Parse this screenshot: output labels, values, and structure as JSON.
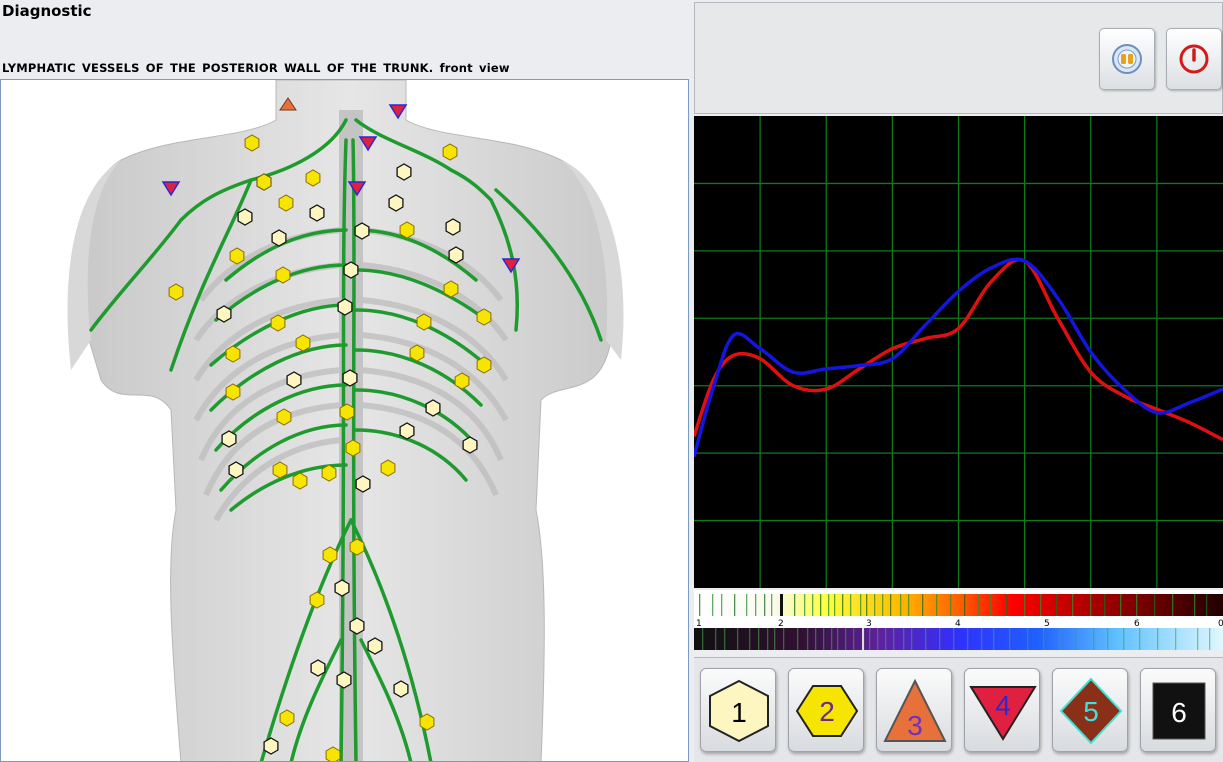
{
  "window": {
    "title": "Diagnostic",
    "subtitle": "LYMPHATIC VESSELS OF THE POSTERIOR WALL OF THE TRUNK. front view"
  },
  "colors": {
    "lymph_vessel": "#1f9a2e",
    "point_light": "#fdf6c0",
    "point_yellow": "#f5e500",
    "marker_orange": "#e8703a",
    "marker_red": "#e02040",
    "marker_blue": "#2a2ad0",
    "curve_red": "#e01010",
    "curve_blue": "#1515e0",
    "grid_green": "#0e7a1a"
  },
  "toolbar": {
    "audio_icon": "audio-icon",
    "power_icon": "power-icon"
  },
  "spectrum": {
    "scale_labels": [
      "1",
      "2",
      "3",
      "4",
      "5",
      "6",
      "0"
    ]
  },
  "mode_buttons": [
    {
      "label": "1",
      "shape": "hexagon-light"
    },
    {
      "label": "2",
      "shape": "hexagon-yellow"
    },
    {
      "label": "3",
      "shape": "triangle-up-orange"
    },
    {
      "label": "4",
      "shape": "triangle-down-red"
    },
    {
      "label": "5",
      "shape": "diamond-brown"
    },
    {
      "label": "6",
      "shape": "square-black"
    }
  ],
  "chart_data": {
    "type": "line",
    "title": "",
    "xlabel": "",
    "ylabel": "",
    "xlim": [
      0,
      8
    ],
    "ylim": [
      0,
      7
    ],
    "grid": true,
    "series": [
      {
        "color": "#e01010",
        "x": [
          0,
          0.3,
          0.6,
          1,
          1.5,
          2,
          2.5,
          3,
          3.5,
          4,
          4.5,
          5,
          5.5,
          6,
          6.5,
          7,
          7.5,
          8
        ],
        "y": [
          2.25,
          3.1,
          3.45,
          3.4,
          3.0,
          2.95,
          3.25,
          3.55,
          3.7,
          3.85,
          4.55,
          4.85,
          4.0,
          3.2,
          2.85,
          2.65,
          2.45,
          2.2
        ]
      },
      {
        "color": "#1515e0",
        "x": [
          0,
          0.3,
          0.6,
          1,
          1.5,
          2,
          2.5,
          3,
          3.5,
          4,
          4.5,
          5,
          5.5,
          6,
          6.5,
          7,
          7.5,
          8
        ],
        "y": [
          1.95,
          3.0,
          3.75,
          3.55,
          3.2,
          3.25,
          3.3,
          3.4,
          3.9,
          4.4,
          4.75,
          4.85,
          4.3,
          3.5,
          2.95,
          2.6,
          2.75,
          2.95
        ]
      }
    ]
  }
}
